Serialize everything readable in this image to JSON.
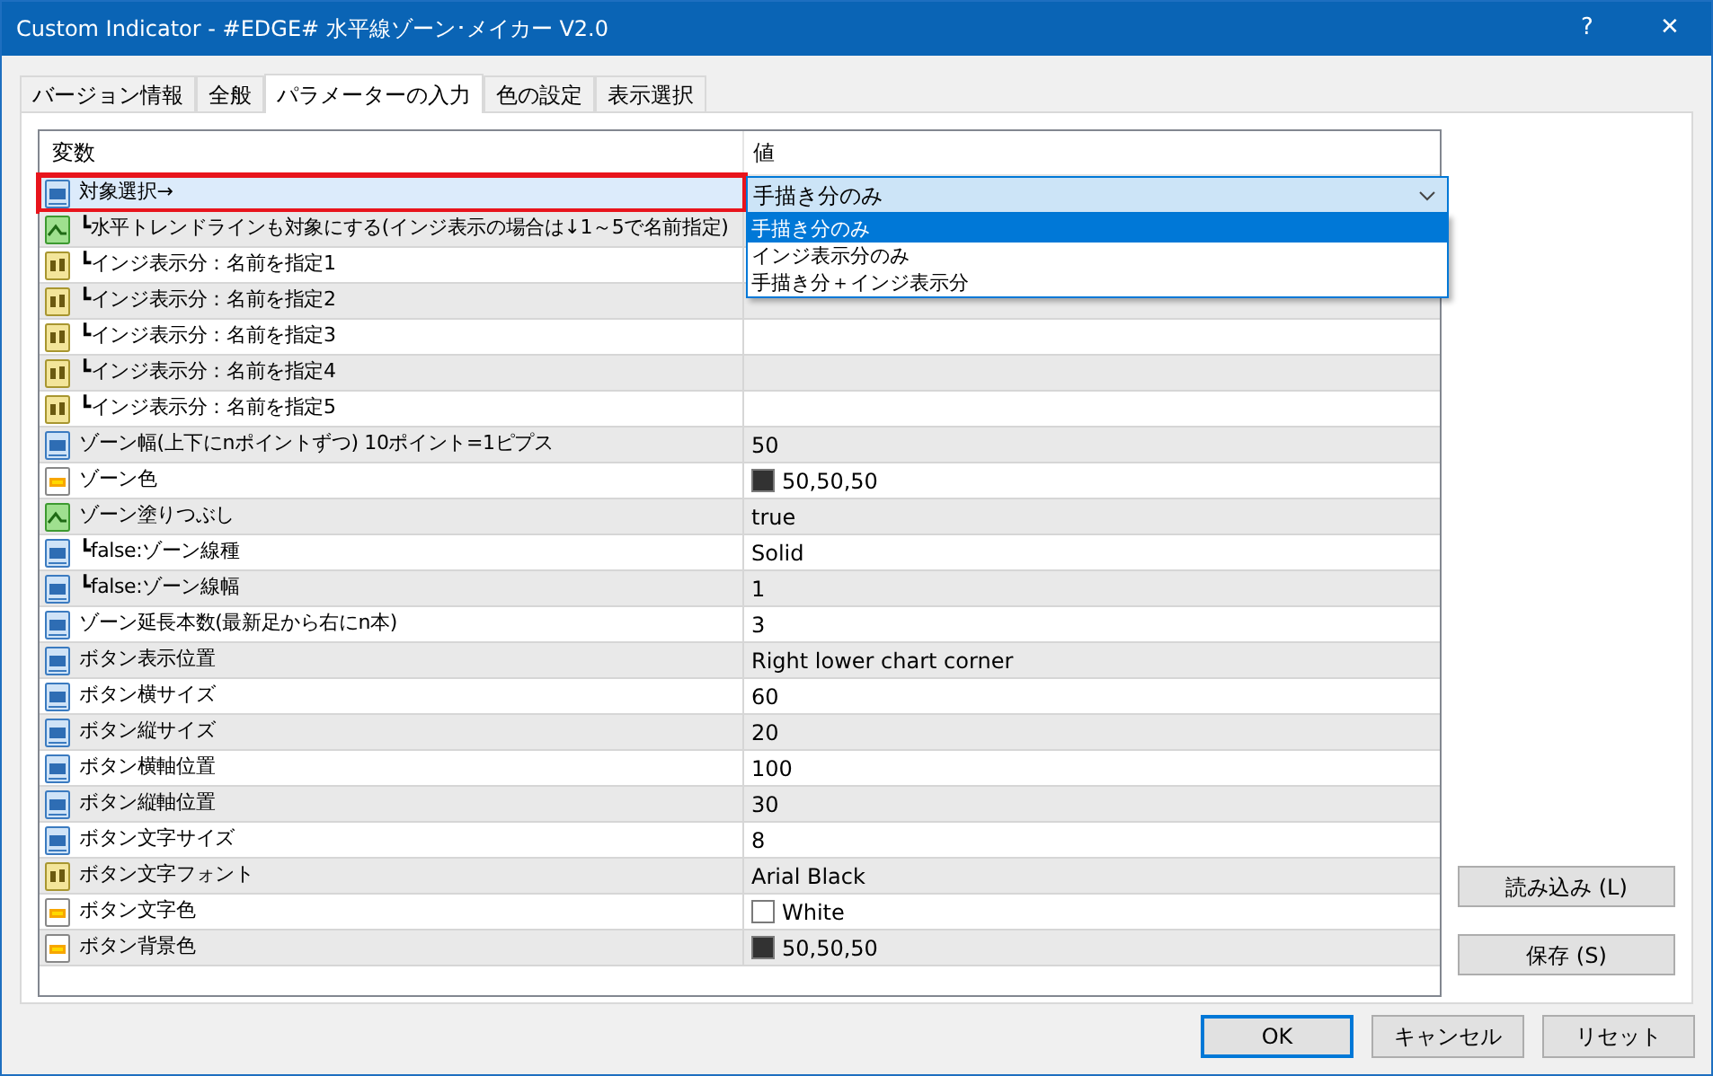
{
  "window": {
    "title": "Custom Indicator - #EDGE# 水平線ゾーン･メイカー V2.0",
    "help": "?",
    "close": "✕"
  },
  "tabs": [
    {
      "label": "バージョン情報",
      "selected": false
    },
    {
      "label": "全般",
      "selected": false
    },
    {
      "label": "パラメーターの入力",
      "selected": true
    },
    {
      "label": "色の設定",
      "selected": false
    },
    {
      "label": "表示選択",
      "selected": false
    }
  ],
  "table": {
    "columns": [
      "変数",
      "値"
    ],
    "rows": [
      {
        "kind": "int",
        "name": "対象選択→",
        "selected": true,
        "annotated": true
      },
      {
        "kind": "bool",
        "name": "┗水平トレンドラインも対象にする(インジ表示の場合は↓1～5で名前指定)",
        "selected": false,
        "annotated": false
      },
      {
        "kind": "string",
        "name": "┗インジ表示分：名前を指定1",
        "selected": false,
        "annotated": false
      },
      {
        "kind": "string",
        "name": "┗インジ表示分：名前を指定2",
        "selected": false,
        "annotated": false
      },
      {
        "kind": "string",
        "name": "┗インジ表示分：名前を指定3",
        "selected": false,
        "annotated": false
      },
      {
        "kind": "string",
        "name": "┗インジ表示分：名前を指定4",
        "selected": false,
        "annotated": false
      },
      {
        "kind": "string",
        "name": "┗インジ表示分：名前を指定5",
        "selected": false,
        "annotated": false
      },
      {
        "kind": "int",
        "name": "ゾーン幅(上下にnポイントずつ) 10ポイント=1ピプス",
        "value": "50",
        "selected": false,
        "annotated": false
      },
      {
        "kind": "color",
        "name": "ゾーン色",
        "value": "50,50,50",
        "color": "#323232",
        "selected": false,
        "annotated": false
      },
      {
        "kind": "bool",
        "name": "ゾーン塗りつぶし",
        "value": "true",
        "selected": false,
        "annotated": false
      },
      {
        "kind": "int",
        "name": "┗false:ゾーン線種",
        "value": "Solid",
        "selected": false,
        "annotated": false
      },
      {
        "kind": "int",
        "name": "┗false:ゾーン線幅",
        "value": "1",
        "selected": false,
        "annotated": false
      },
      {
        "kind": "int",
        "name": "ゾーン延長本数(最新足から右にn本)",
        "value": "3",
        "selected": false,
        "annotated": false
      },
      {
        "kind": "int",
        "name": "ボタン表示位置",
        "value": "Right lower chart corner",
        "selected": false,
        "annotated": false
      },
      {
        "kind": "int",
        "name": "ボタン横サイズ",
        "value": "60",
        "selected": false,
        "annotated": false
      },
      {
        "kind": "int",
        "name": "ボタン縦サイズ",
        "value": "20",
        "selected": false,
        "annotated": false
      },
      {
        "kind": "int",
        "name": "ボタン横軸位置",
        "value": "100",
        "selected": false,
        "annotated": false
      },
      {
        "kind": "int",
        "name": "ボタン縦軸位置",
        "value": "30",
        "selected": false,
        "annotated": false
      },
      {
        "kind": "int",
        "name": "ボタン文字サイズ",
        "value": "8",
        "selected": false,
        "annotated": false
      },
      {
        "kind": "string",
        "name": "ボタン文字フォント",
        "value": "Arial Black",
        "selected": false,
        "annotated": false
      },
      {
        "kind": "color",
        "name": "ボタン文字色",
        "value": "White",
        "color": "#ffffff",
        "selected": false,
        "annotated": false
      },
      {
        "kind": "color",
        "name": "ボタン背景色",
        "value": "50,50,50",
        "color": "#323232",
        "selected": false,
        "annotated": false
      }
    ]
  },
  "dropdown": {
    "value": "手描き分のみ",
    "options": [
      {
        "label": "手描き分のみ",
        "selected": true
      },
      {
        "label": "インジ表示分のみ",
        "selected": false
      },
      {
        "label": "手描き分＋インジ表示分",
        "selected": false
      }
    ]
  },
  "side_buttons": [
    "読み込み (L)",
    "保存 (S)"
  ],
  "buttons": [
    {
      "label": "OK",
      "default": true
    },
    {
      "label": "キャンセル",
      "default": false
    },
    {
      "label": "リセット",
      "default": false
    }
  ]
}
